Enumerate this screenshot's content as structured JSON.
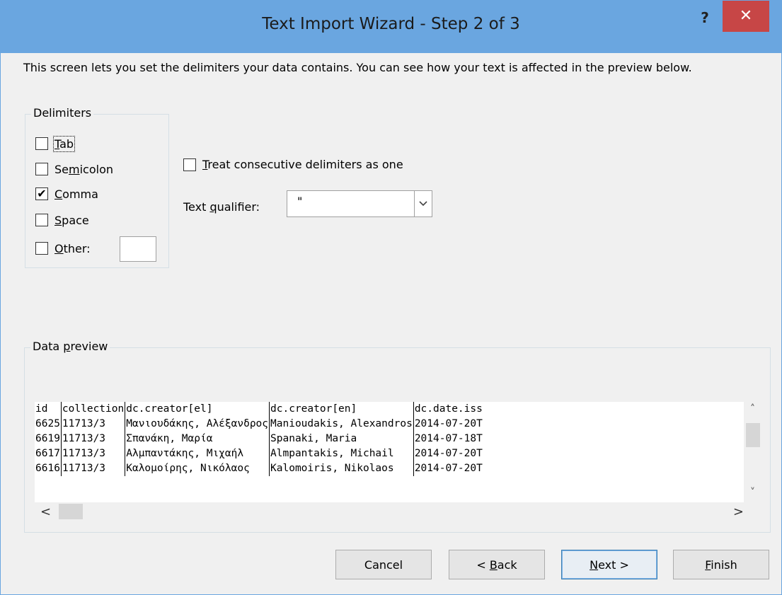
{
  "window": {
    "title": "Text Import Wizard - Step 2 of 3",
    "help_label": "?",
    "close_label": "✕",
    "accent_color": "#6aa6e0",
    "close_color": "#c74646"
  },
  "intro": "This screen lets you set the delimiters your data contains.  You can see how your text is affected in the preview below.",
  "delimiters": {
    "title": "Delimiters",
    "options": [
      {
        "pre": "",
        "key": "T",
        "post": "ab",
        "checked": false
      },
      {
        "pre": "Se",
        "key": "m",
        "post": "icolon",
        "checked": false
      },
      {
        "pre": "",
        "key": "C",
        "post": "omma",
        "checked": true
      },
      {
        "pre": "",
        "key": "S",
        "post": "pace",
        "checked": false
      },
      {
        "pre": "",
        "key": "O",
        "post": "ther:",
        "checked": false
      }
    ],
    "other_value": ""
  },
  "consecutive": {
    "pre": "",
    "key": "T",
    "post": "reat consecutive delimiters as one",
    "checked": false
  },
  "text_qualifier": {
    "pre": "Text ",
    "key": "q",
    "post": "ualifier:",
    "value": "\""
  },
  "preview": {
    "title_pre": "Data ",
    "title_key": "p",
    "title_post": "review",
    "rows": [
      [
        "id",
        "collection",
        "dc.creator[el]",
        "dc.creator[en]",
        "dc.date.iss"
      ],
      [
        "6625",
        "11713/3",
        "Μανιουδάκης, Αλέξανδρος",
        "Manioudakis, Alexandros",
        "2014-07-20T"
      ],
      [
        "6619",
        "11713/3",
        "Σπανάκη, Μαρία",
        "Spanaki, Maria",
        "2014-07-18T"
      ],
      [
        "6617",
        "11713/3",
        "Αλμπαντάκης, Μιχαήλ",
        "Almpantakis, Michail",
        "2014-07-20T"
      ],
      [
        "6616",
        "11713/3",
        "Καλομοίρης, Νικόλαος",
        "Kalomoiris, Nikolaos",
        "2014-07-20T"
      ]
    ]
  },
  "scroll": {
    "up": "˄",
    "down": "˅",
    "left": "<",
    "right": ">"
  },
  "buttons": {
    "cancel": "Cancel",
    "back_pre": "< ",
    "back_key": "B",
    "back_post": "ack",
    "next_key": "N",
    "next_post": "ext >",
    "finish_key": "F",
    "finish_post": "inish"
  }
}
